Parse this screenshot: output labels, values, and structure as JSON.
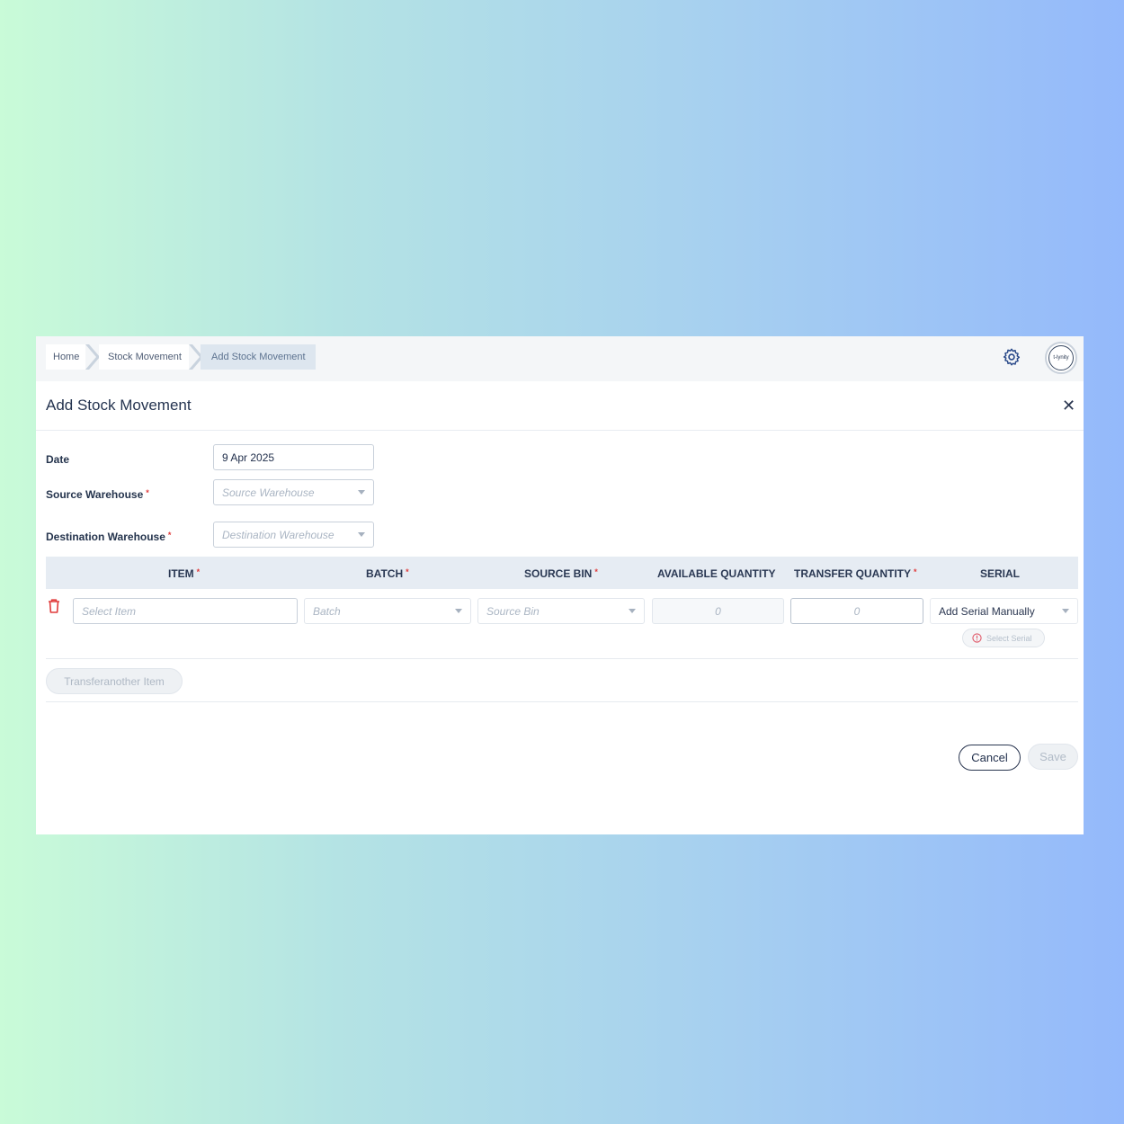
{
  "breadcrumb": [
    "Home",
    "Stock Movement",
    "Add Stock Movement"
  ],
  "avatar_text": "t-lynity",
  "page_title": "Add Stock Movement",
  "form": {
    "date_label": "Date",
    "date_value": "9 Apr 2025",
    "source_warehouse_label": "Source Warehouse",
    "source_warehouse_placeholder": "Source Warehouse",
    "destination_warehouse_label": "Destination Warehouse",
    "destination_warehouse_placeholder": "Destination Warehouse",
    "required_mark": "*"
  },
  "table": {
    "columns": [
      "ITEM",
      "BATCH",
      "SOURCE BIN",
      "AVAILABLE QUANTITY",
      "TRANSFER QUANTITY",
      "SERIAL"
    ],
    "row": {
      "item_placeholder": "Select Item",
      "batch_placeholder": "Batch",
      "source_bin_placeholder": "Source Bin",
      "available_quantity": "0",
      "transfer_quantity_placeholder": "0",
      "serial_value": "Add Serial Manually",
      "select_serial_label": "Select Serial"
    }
  },
  "buttons": {
    "transfer_another": "Transferanother Item",
    "cancel": "Cancel",
    "save": "Save"
  },
  "colors": {
    "accent": "#2a3650",
    "required": "#e03a3a",
    "header_bg": "#e6ecf3",
    "error": "#e05a6a"
  },
  "icons": [
    "gear-icon",
    "close-icon",
    "trash-icon",
    "chevron-down-icon",
    "error-circle-icon"
  ]
}
